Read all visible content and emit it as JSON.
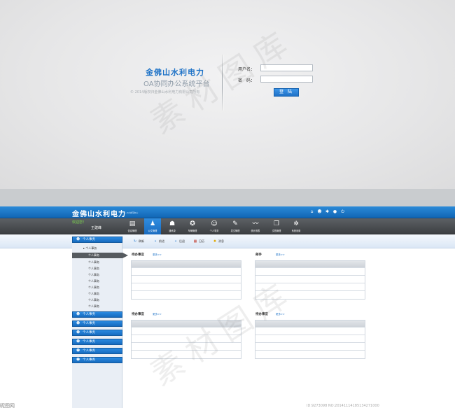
{
  "login": {
    "title": "金佛山水利电力",
    "subtitle": "OA协同办公系统平台",
    "copyright": "© 2014版权归金佛山水利电力有限公司所有",
    "username_label": "用户名：",
    "password_label": "密　码：",
    "username_value": "",
    "password_value": "",
    "login_button": "登 陆"
  },
  "app": {
    "title": "金佛山水利电力",
    "title_sub": "—OA协同办公",
    "header_icons": [
      "home-icon",
      "users-icon",
      "gear-icon",
      "help-icon",
      "power-icon"
    ]
  },
  "user": {
    "welcome": "欢迎您！",
    "name": "王建峰"
  },
  "toolbar": {
    "items": [
      {
        "label": "信息管理",
        "icon": "newspaper-icon"
      },
      {
        "label": "公文管理",
        "icon": "document-person-icon",
        "active": true
      },
      {
        "label": "通讯录",
        "icon": "contacts-icon"
      },
      {
        "label": "车辆管理",
        "icon": "ribbon-icon"
      },
      {
        "label": "个人事务",
        "icon": "people-icon"
      },
      {
        "label": "发文管理",
        "icon": "file-edit-icon"
      },
      {
        "label": "统计报表",
        "icon": "chart-line-icon"
      },
      {
        "label": "文档管理",
        "icon": "documents-icon"
      },
      {
        "label": "系统设置",
        "icon": "settings-icon"
      }
    ]
  },
  "actions": [
    {
      "label": "刷新",
      "icon": "refresh-icon"
    },
    {
      "label": "前进",
      "icon": "forward-icon"
    },
    {
      "label": "后退",
      "icon": "back-icon"
    },
    {
      "label": "日历",
      "icon": "calendar-icon"
    },
    {
      "label": "消息",
      "icon": "bulb-icon"
    }
  ],
  "sidebar": {
    "top_group": "个人事务",
    "sub_items": [
      "个人事务",
      "个人事务",
      "个人事务",
      "个人事务",
      "个人事务",
      "个人事务",
      "个人事务",
      "个人事务",
      "个人事务",
      "个人事务"
    ],
    "selected_index": 1,
    "groups": [
      "个人事务",
      "个人事务",
      "个人事务",
      "个人事务",
      "个人事务",
      "个人事务",
      "个人事务"
    ]
  },
  "panels": [
    {
      "title": "待办事宜",
      "more": "更多>>"
    },
    {
      "title": "邮件",
      "more": "更多>>"
    },
    {
      "title": "待办事宜",
      "more": "更多>>"
    },
    {
      "title": "待办事宜",
      "more": "更多>>"
    }
  ],
  "watermark": {
    "text": "素材图库",
    "bottom_left": "昵图网",
    "bottom_right": "ID:9273098 NO:20141114185134271000"
  }
}
